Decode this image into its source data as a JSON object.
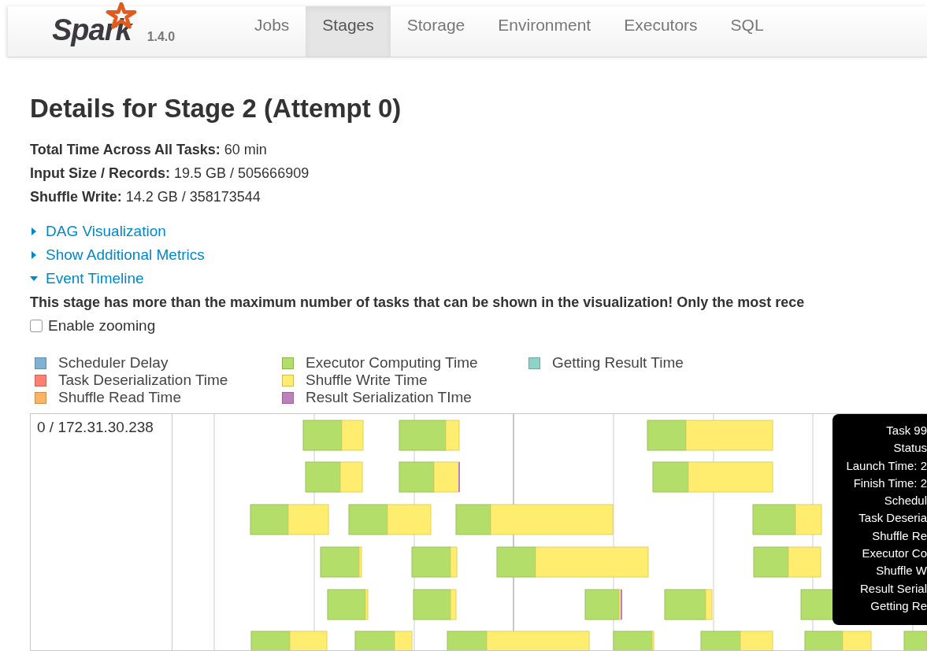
{
  "navbar": {
    "logo": "Spark",
    "version": "1.4.0",
    "tabs": [
      {
        "label": "Jobs",
        "selected": false
      },
      {
        "label": "Stages",
        "selected": true
      },
      {
        "label": "Storage",
        "selected": false
      },
      {
        "label": "Environment",
        "selected": false
      },
      {
        "label": "Executors",
        "selected": false
      },
      {
        "label": "SQL",
        "selected": false
      }
    ]
  },
  "title": "Details for Stage 2 (Attempt 0)",
  "summary": [
    {
      "label": "Total Time Across All Tasks:",
      "value": "60 min"
    },
    {
      "label": "Input Size / Records:",
      "value": "19.5 GB / 505666909"
    },
    {
      "label": "Shuffle Write:",
      "value": "14.2 GB / 358173544"
    }
  ],
  "sections": [
    {
      "label": "DAG Visualization",
      "expanded": false
    },
    {
      "label": "Show Additional Metrics",
      "expanded": false
    },
    {
      "label": "Event Timeline",
      "expanded": true
    }
  ],
  "warning": "This stage has more than the maximum number of tasks that can be shown in the visualization! Only the most rece",
  "zoom_toggle": {
    "label": "Enable zooming",
    "checked": false
  },
  "legend": [
    {
      "label": "Scheduler Delay",
      "color": "#80b1d3"
    },
    {
      "label": "Task Deserialization Time",
      "color": "#fb8072"
    },
    {
      "label": "Shuffle Read Time",
      "color": "#fdb462"
    },
    {
      "label": "Executor Computing Time",
      "color": "#b3de69"
    },
    {
      "label": "Shuffle Write Time",
      "color": "#ffed6f"
    },
    {
      "label": "Result Serialization TIme",
      "color": "#bc80bd"
    },
    {
      "label": "Getting Result Time",
      "color": "#8dd3c7"
    }
  ],
  "timeline": {
    "executor": "0 / 172.31.30.238",
    "tooltip": [
      "Task 99",
      "Status",
      "Launch Time: 2",
      "Finish Time: 2",
      "Schedul",
      "Task Deseria",
      "Shuffle Re",
      "Executor Co",
      "Shuffle W",
      "Result Serial",
      "Getting Re"
    ]
  }
}
